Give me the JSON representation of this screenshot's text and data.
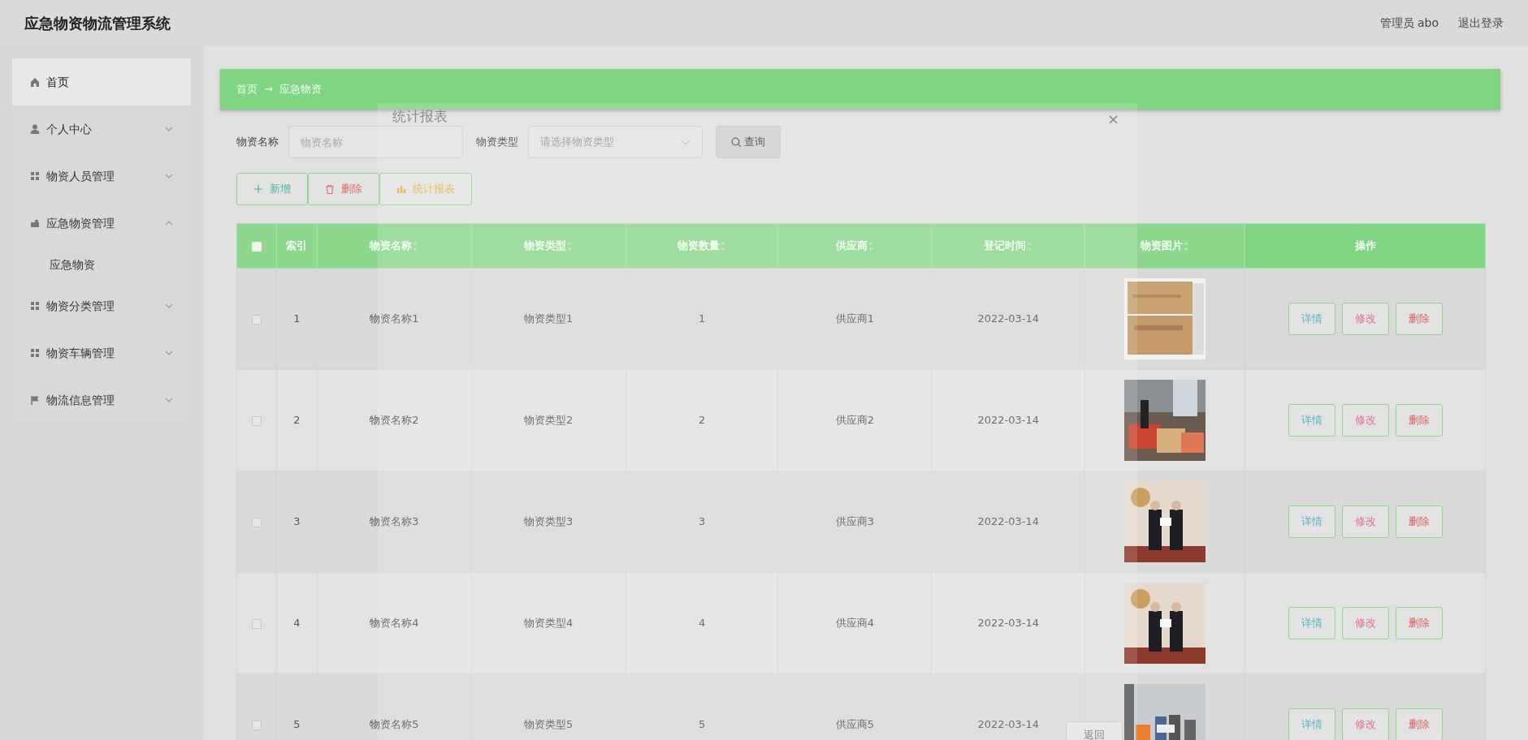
{
  "header": {
    "title": "应急物资物流管理系统",
    "user": "管理员 abo",
    "logout": "退出登录"
  },
  "sidebar": {
    "items": [
      {
        "label": "首页",
        "kind": "link",
        "selected": true
      },
      {
        "label": "个人中心",
        "kind": "submenu",
        "expanded": false,
        "selected": false
      },
      {
        "label": "物资人员管理",
        "kind": "submenu",
        "expanded": false,
        "selected": false
      },
      {
        "label": "应急物资管理",
        "kind": "submenu",
        "expanded": true,
        "selected": false,
        "children": [
          {
            "label": "应急物资"
          }
        ]
      },
      {
        "label": "物资分类管理",
        "kind": "submenu",
        "expanded": false,
        "selected": false
      },
      {
        "label": "物资车辆管理",
        "kind": "submenu",
        "expanded": false,
        "selected": false
      },
      {
        "label": "物流信息管理",
        "kind": "submenu",
        "expanded": false,
        "selected": false
      }
    ]
  },
  "breadcrumb": {
    "items": [
      "首页",
      "应急物资"
    ],
    "separator": "→"
  },
  "search": {
    "fields": [
      {
        "label": "物资名称",
        "placeholder": "物资名称",
        "kind": "input"
      },
      {
        "label": "物资类型",
        "placeholder": "请选择物资类型",
        "kind": "select"
      }
    ],
    "button": "查询"
  },
  "toolbar": [
    {
      "label": "新增",
      "kind": "add"
    },
    {
      "label": "删除",
      "kind": "delete"
    },
    {
      "label": "统计报表",
      "kind": "chart"
    }
  ],
  "table": {
    "header_checked": false,
    "columns": [
      {
        "label": "索引",
        "sortable": false
      },
      {
        "label": "物资名称",
        "sortable": true
      },
      {
        "label": "物资类型",
        "sortable": true
      },
      {
        "label": "物资数量",
        "sortable": true
      },
      {
        "label": "供应商",
        "sortable": true
      },
      {
        "label": "登记时间",
        "sortable": true
      },
      {
        "label": "物资图片",
        "sortable": true
      },
      {
        "label": "操作",
        "sortable": false
      }
    ],
    "rows": [
      {
        "checked": false,
        "cells": [
          "1",
          "物资名称1",
          "物资类型1",
          "1",
          "供应商1",
          "2022-03-14"
        ],
        "image": {
          "kind": "picture"
        },
        "actions": [
          "详情",
          "修改",
          "删除"
        ]
      },
      {
        "checked": false,
        "cells": [
          "2",
          "物资名称2",
          "物资类型2",
          "2",
          "供应商2",
          "2022-03-14"
        ],
        "image": {
          "kind": "picture"
        },
        "actions": [
          "详情",
          "修改",
          "删除"
        ]
      },
      {
        "checked": false,
        "cells": [
          "3",
          "物资名称3",
          "物资类型3",
          "3",
          "供应商3",
          "2022-03-14"
        ],
        "image": {
          "kind": "picture"
        },
        "actions": [
          "详情",
          "修改",
          "删除"
        ]
      },
      {
        "checked": false,
        "cells": [
          "4",
          "物资名称4",
          "物资类型4",
          "4",
          "供应商4",
          "2022-03-14"
        ],
        "image": {
          "kind": "picture"
        },
        "actions": [
          "详情",
          "修改",
          "删除"
        ]
      },
      {
        "checked": false,
        "cells": [
          "5",
          "物资名称5",
          "物资类型5",
          "5",
          "供应商5",
          "2022-03-14"
        ],
        "image": {
          "kind": "picture"
        },
        "actions": [
          "详情",
          "修改",
          "删除"
        ]
      }
    ]
  },
  "dialog": {
    "title": "统计报表",
    "close": "×",
    "back_button": "返回"
  }
}
